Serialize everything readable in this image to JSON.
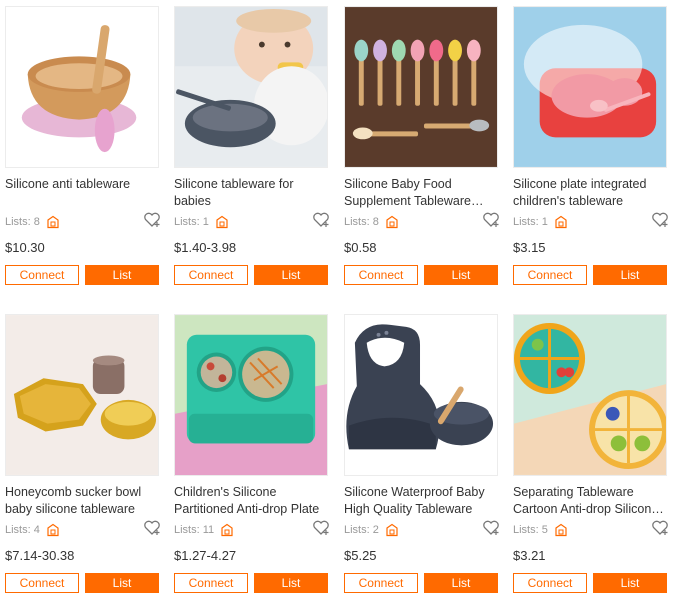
{
  "products": [
    {
      "title": "Silicone anti tableware",
      "lists": "Lists: 8",
      "price": "$10.30",
      "connect": "Connect",
      "list": "List",
      "image": "bamboo-bowl-pink-base"
    },
    {
      "title": "Silicone tableware for babies",
      "lists": "Lists: 1",
      "price": "$1.40-3.98",
      "connect": "Connect",
      "list": "List",
      "image": "baby-eating-grey-bowl"
    },
    {
      "title": "Silicone Baby Food Supplement Tableware Spoon",
      "lists": "Lists: 8",
      "price": "$0.58",
      "connect": "Connect",
      "list": "List",
      "image": "colored-spoons-wood"
    },
    {
      "title": "Silicone plate integrated children's tableware",
      "lists": "Lists: 1",
      "price": "$3.15",
      "connect": "Connect",
      "list": "List",
      "image": "red-suction-plate"
    },
    {
      "title": "Honeycomb sucker bowl baby silicone tableware",
      "lists": "Lists: 4",
      "price": "$7.14-30.38",
      "connect": "Connect",
      "list": "List",
      "image": "mustard-hexagon-set"
    },
    {
      "title": "Children's Silicone Partitioned Anti-drop Plate",
      "lists": "Lists: 11",
      "price": "$1.27-4.27",
      "connect": "Connect",
      "list": "List",
      "image": "teal-placemat-plate"
    },
    {
      "title": "Silicone Waterproof Baby High Quality Tableware",
      "lists": "Lists: 2",
      "price": "$5.25",
      "connect": "Connect",
      "list": "List",
      "image": "navy-bib-bowl"
    },
    {
      "title": "Separating Tableware Cartoon Anti-drop Silicone Plate",
      "lists": "Lists: 5",
      "price": "$3.21",
      "connect": "Connect",
      "list": "List",
      "image": "divided-plates-food"
    }
  ],
  "colors": {
    "accent": "#ff6a00",
    "muted": "#999999"
  }
}
